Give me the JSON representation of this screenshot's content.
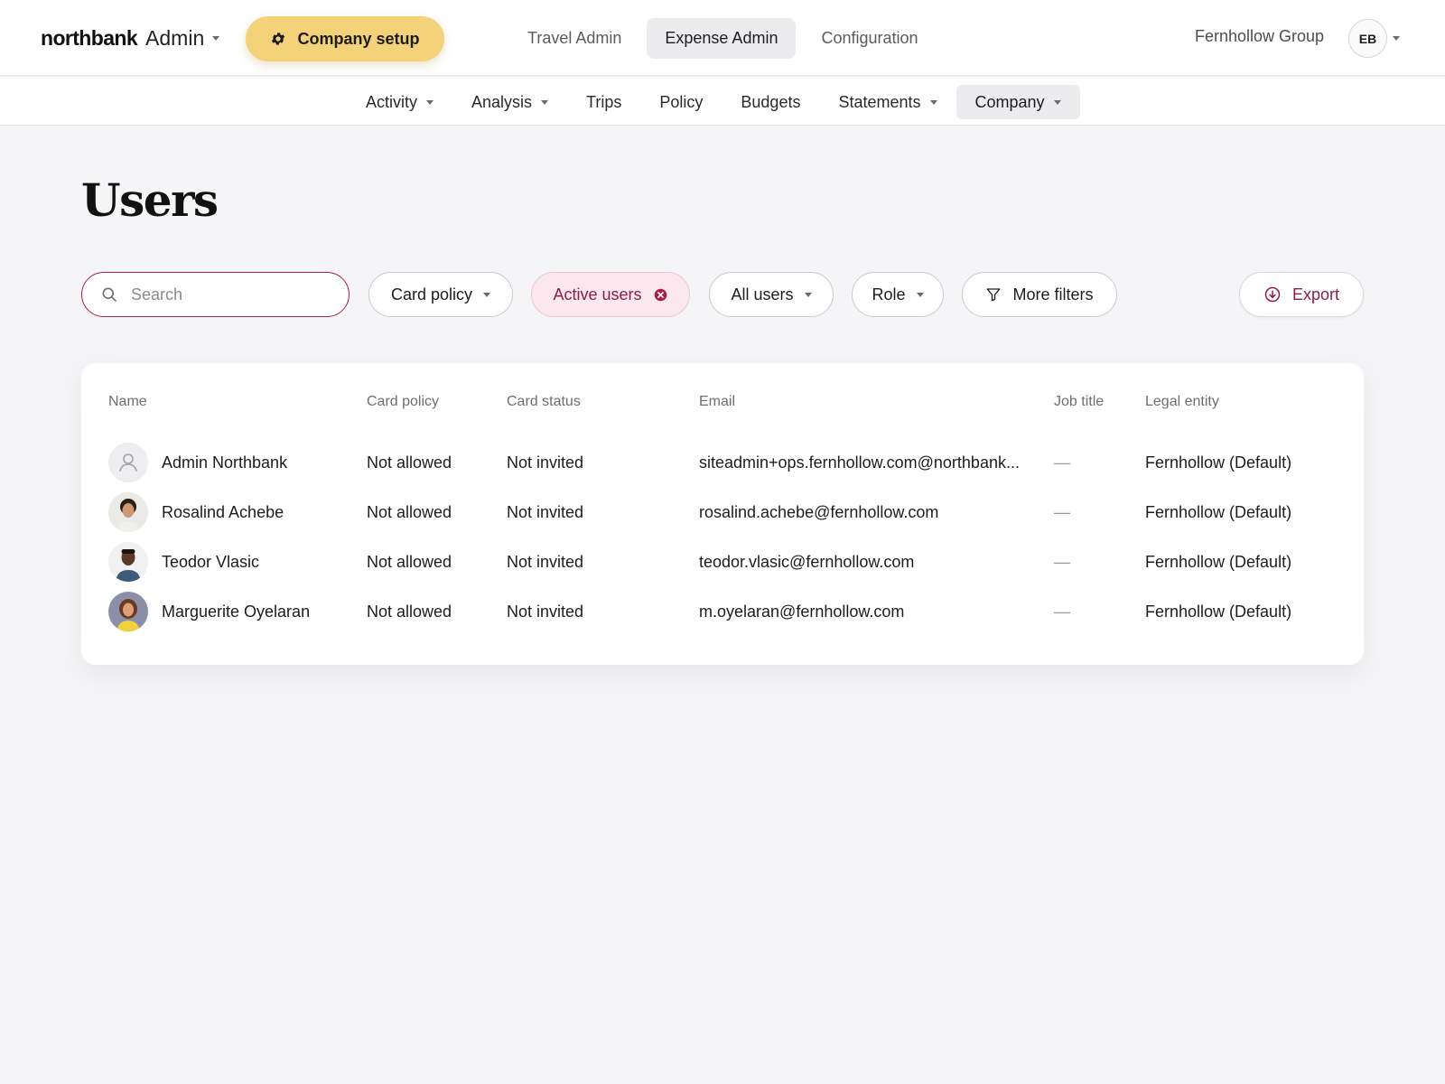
{
  "brand": {
    "name": "northbank",
    "suffix": "Admin"
  },
  "setup_button": {
    "label": "Company setup"
  },
  "top_tabs": [
    {
      "label": "Travel Admin",
      "active": false
    },
    {
      "label": "Expense Admin",
      "active": true
    },
    {
      "label": "Configuration",
      "active": false
    }
  ],
  "org_name": "Fernhollow Group",
  "user_initials": "EB",
  "subnav": [
    {
      "label": "Activity",
      "dropdown": true
    },
    {
      "label": "Analysis",
      "dropdown": true
    },
    {
      "label": "Trips",
      "dropdown": false
    },
    {
      "label": "Policy",
      "dropdown": false
    },
    {
      "label": "Budgets",
      "dropdown": false
    },
    {
      "label": "Statements",
      "dropdown": true
    },
    {
      "label": "Company",
      "dropdown": true,
      "active": true
    }
  ],
  "page": {
    "title": "Users"
  },
  "filters": {
    "search_placeholder": "Search",
    "card_policy": "Card policy",
    "active_users": "Active users",
    "all_users": "All users",
    "role": "Role",
    "more_filters": "More filters",
    "export": "Export"
  },
  "table": {
    "headers": {
      "name": "Name",
      "card_policy": "Card policy",
      "card_status": "Card status",
      "email": "Email",
      "job_title": "Job title",
      "legal_entity": "Legal entity"
    },
    "rows": [
      {
        "name": "Admin Northbank",
        "avatar": "placeholder-person-icon",
        "card_policy": "Not allowed",
        "card_status": "Not invited",
        "email": "siteadmin+ops.fernhollow.com@northbank...",
        "job_title": "—",
        "legal_entity": "Fernhollow (Default)"
      },
      {
        "name": "Rosalind Achebe",
        "avatar": "photo",
        "card_policy": "Not allowed",
        "card_status": "Not invited",
        "email": "rosalind.achebe@fernhollow.com",
        "job_title": "—",
        "legal_entity": "Fernhollow (Default)"
      },
      {
        "name": "Teodor Vlasic",
        "avatar": "photo",
        "card_policy": "Not allowed",
        "card_status": "Not invited",
        "email": "teodor.vlasic@fernhollow.com",
        "job_title": "—",
        "legal_entity": "Fernhollow (Default)"
      },
      {
        "name": "Marguerite Oyelaran",
        "avatar": "photo",
        "card_policy": "Not allowed",
        "card_status": "Not invited",
        "email": "m.oyelaran@fernhollow.com",
        "job_title": "—",
        "legal_entity": "Fernhollow (Default)"
      }
    ]
  },
  "colors": {
    "accent": "#a61e4d",
    "setup_button_bg": "#f4d27a",
    "page_bg": "#f5f5f7"
  }
}
